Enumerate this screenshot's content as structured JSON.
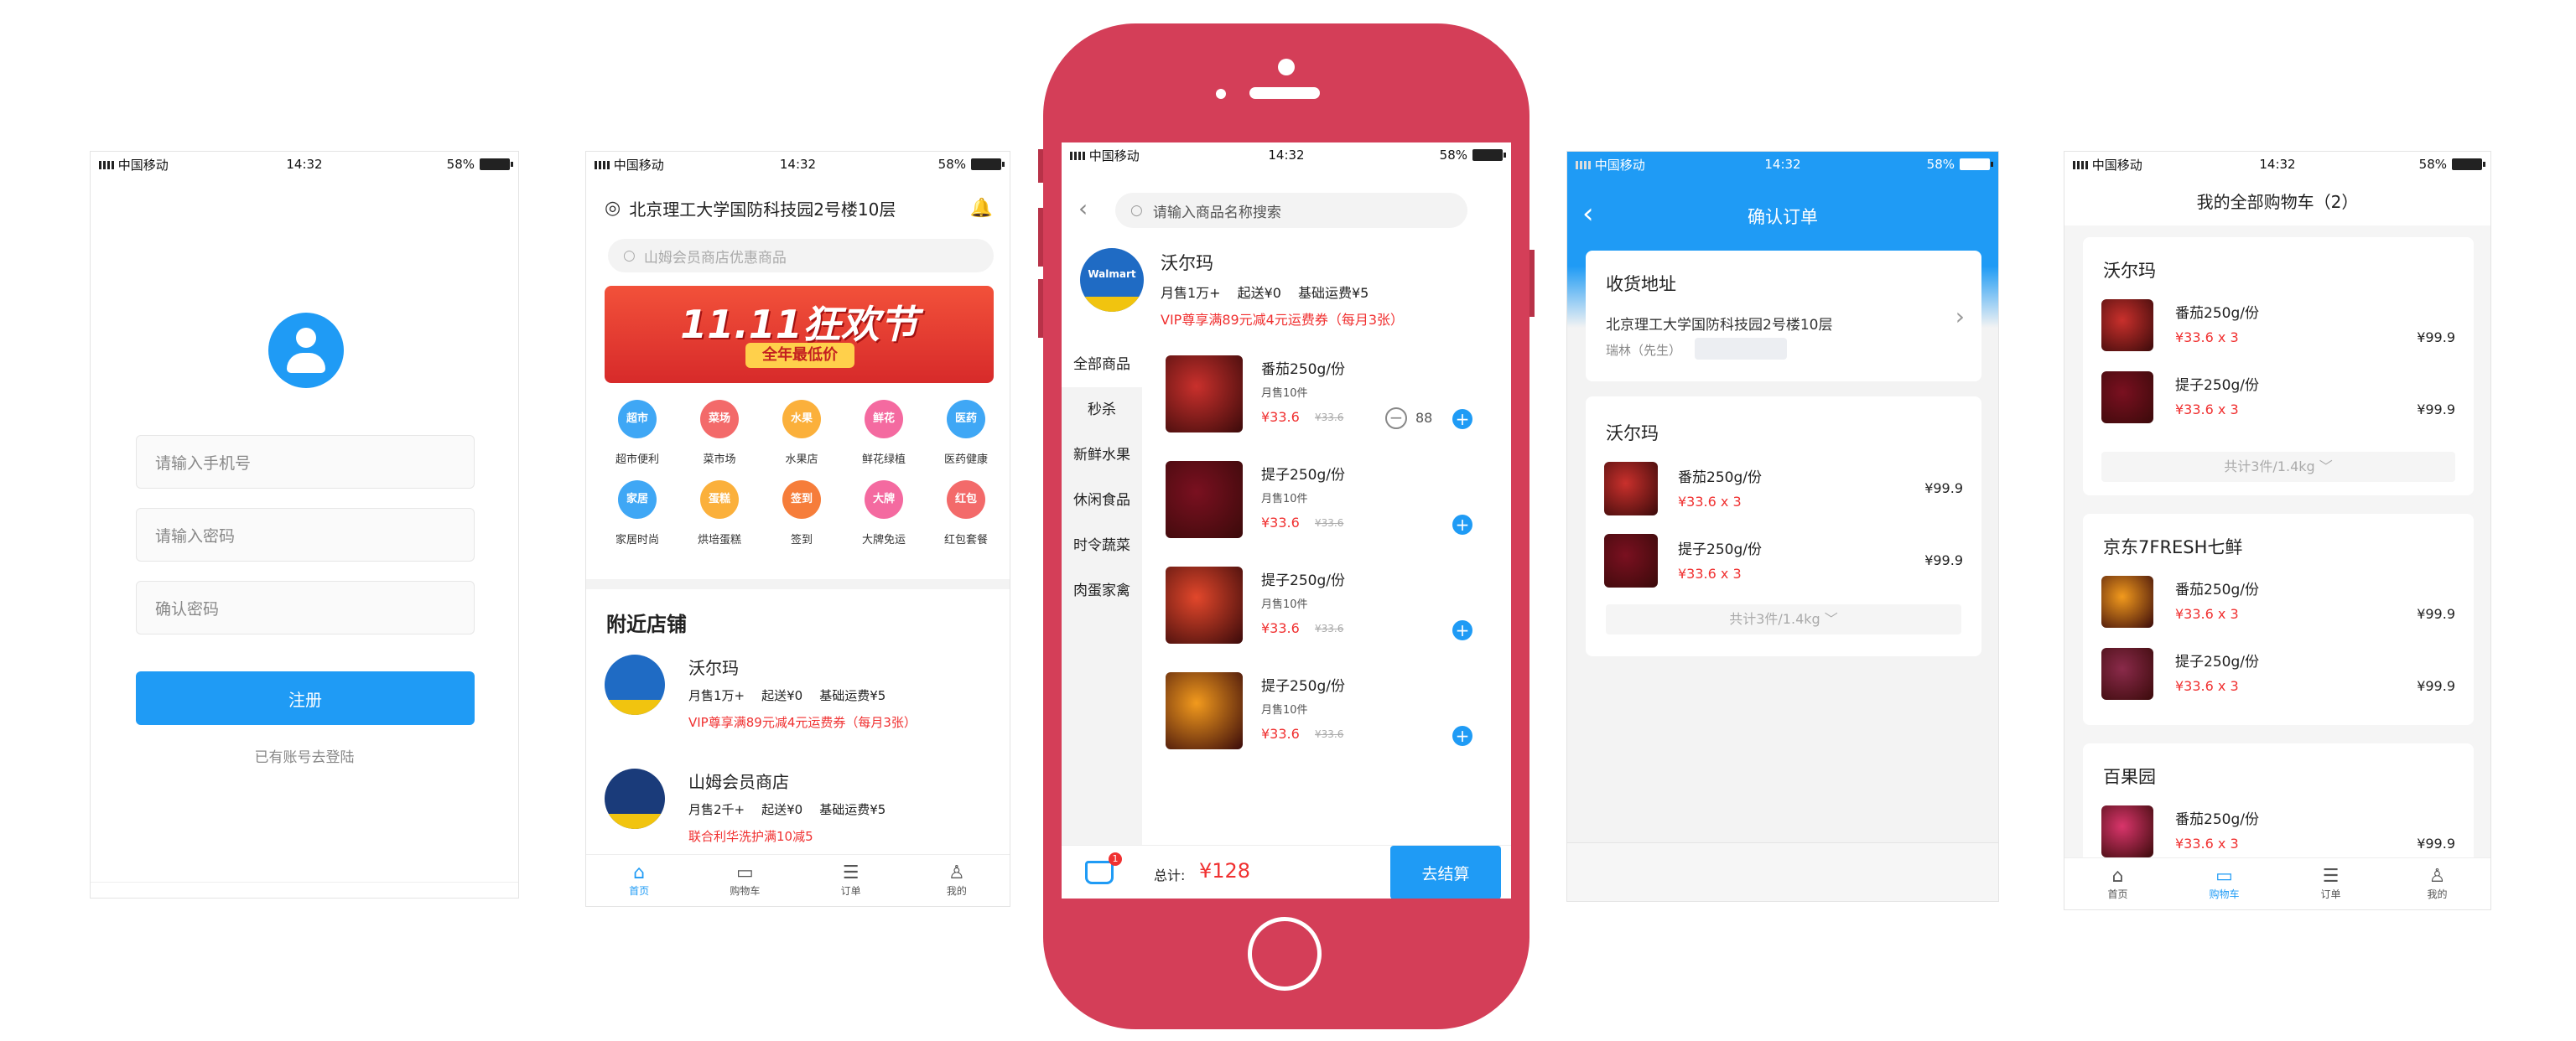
{
  "status": {
    "carrier": "中国移动",
    "time": "14:32",
    "battery": "58%"
  },
  "register": {
    "phone_placeholder": "请输入手机号",
    "password_placeholder": "请输入密码",
    "confirm_placeholder": "确认密码",
    "submit": "注册",
    "login_link": "已有账号去登陆"
  },
  "home": {
    "address": "北京理工大学国防科技园2号楼10层",
    "search_placeholder": "山姆会员商店优惠商品",
    "banner_title": "11.11狂欢节",
    "banner_sub": "全年最低价",
    "categories": [
      {
        "icon": "超市",
        "label": "超市便利",
        "color": "#3fa7f5"
      },
      {
        "icon": "菜场",
        "label": "菜市场",
        "color": "#f36a6a"
      },
      {
        "icon": "水果",
        "label": "水果店",
        "color": "#fbb03b"
      },
      {
        "icon": "鲜花",
        "label": "鲜花绿植",
        "color": "#f46aa0"
      },
      {
        "icon": "医药",
        "label": "医药健康",
        "color": "#3fa7f5"
      },
      {
        "icon": "家居",
        "label": "家居时尚",
        "color": "#3fa7f5"
      },
      {
        "icon": "蛋糕",
        "label": "烘培蛋糕",
        "color": "#fbb03b"
      },
      {
        "icon": "签到",
        "label": "签到",
        "color": "#f67d3a"
      },
      {
        "icon": "大牌",
        "label": "大牌免运",
        "color": "#f46aa0"
      },
      {
        "icon": "红包",
        "label": "红包套餐",
        "color": "#f36a6a"
      }
    ],
    "nearby_title": "附近店铺",
    "stores": [
      {
        "name": "沃尔玛",
        "sales": "月售1万+",
        "min": "起送¥0",
        "fee": "基础运费¥5",
        "promo": "VIP尊享满89元减4元运费券（每月3张）"
      },
      {
        "name": "山姆会员商店",
        "sales": "月售2千+",
        "min": "起送¥0",
        "fee": "基础运费¥5",
        "promo": "联合利华洗护满10减5"
      }
    ],
    "tabs": [
      "首页",
      "购物车",
      "订单",
      "我的"
    ]
  },
  "store": {
    "search_placeholder": "请输入商品名称搜索",
    "name": "沃尔玛",
    "sales": "月售1万+",
    "min": "起送¥0",
    "fee": "基础运费¥5",
    "promo": "VIP尊享满89元减4元运费券（每月3张）",
    "logo_text": "Walmart",
    "categories": [
      "全部商品",
      "秒杀",
      "新鲜水果",
      "休闲食品",
      "时令蔬菜",
      "肉蛋家禽"
    ],
    "products": [
      {
        "name": "番茄250g/份",
        "sales": "月售10件",
        "price": "¥33.6",
        "old": "¥33.6",
        "qty": "88",
        "color": "#c9302c"
      },
      {
        "name": "提子250g/份",
        "sales": "月售10件",
        "price": "¥33.6",
        "old": "¥33.6",
        "qty": "",
        "color": "#7a1020"
      },
      {
        "name": "提子250g/份",
        "sales": "月售10件",
        "price": "¥33.6",
        "old": "¥33.6",
        "qty": "",
        "color": "#e2472b"
      },
      {
        "name": "提子250g/份",
        "sales": "月售10件",
        "price": "¥33.6",
        "old": "¥33.6",
        "qty": "",
        "color": "#f29a1d"
      }
    ],
    "cart_badge": "1",
    "total_label": "总计:",
    "total": "¥128",
    "checkout": "去结算"
  },
  "confirm": {
    "title": "确认订单",
    "address_title": "收货地址",
    "address": "北京理工大学国防科技园2号楼10层",
    "contact": "瑞林（先生）",
    "store": "沃尔玛",
    "items": [
      {
        "name": "番茄250g/份",
        "qty": "¥33.6 x 3",
        "total": "¥99.9",
        "color": "#c9302c"
      },
      {
        "name": "提子250g/份",
        "qty": "¥33.6 x 3",
        "total": "¥99.9",
        "color": "#7a1020"
      }
    ],
    "summary": "共计3件/1.4kg ﹀"
  },
  "cart": {
    "title": "我的全部购物车（2）",
    "groups": [
      {
        "store": "沃尔玛",
        "items": [
          {
            "name": "番茄250g/份",
            "qty": "¥33.6 x 3",
            "total": "¥99.9",
            "color": "#c9302c"
          },
          {
            "name": "提子250g/份",
            "qty": "¥33.6 x 3",
            "total": "¥99.9",
            "color": "#7a1020"
          }
        ],
        "summary": "共计3件/1.4kg ﹀"
      },
      {
        "store": "京东7FRESH七鲜",
        "items": [
          {
            "name": "番茄250g/份",
            "qty": "¥33.6 x 3",
            "total": "¥99.9",
            "color": "#f29a1d"
          },
          {
            "name": "提子250g/份",
            "qty": "¥33.6 x 3",
            "total": "¥99.9",
            "color": "#8a2a4a"
          }
        ]
      },
      {
        "store": "百果园",
        "items": [
          {
            "name": "番茄250g/份",
            "qty": "¥33.6 x 3",
            "total": "¥99.9",
            "color": "#d9356b"
          }
        ]
      }
    ],
    "tabs": [
      "首页",
      "购物车",
      "订单",
      "我的"
    ]
  }
}
